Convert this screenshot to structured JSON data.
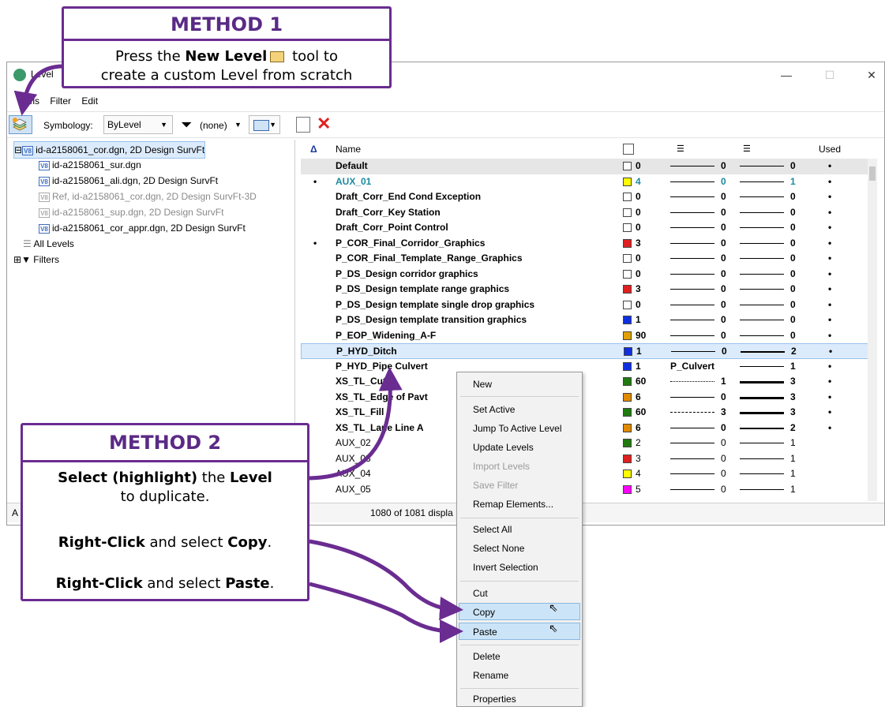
{
  "method1": {
    "heading": "METHOD 1",
    "line1_pre": "Press the ",
    "line1_bold": "New Level",
    "line1_post": " tool to",
    "line2": "create a custom Level from scratch"
  },
  "method2": {
    "heading": "METHOD 2",
    "p1_bold1": "Select (highlight)",
    "p1_mid": " the ",
    "p1_bold2": "Level",
    "p1_line2": "to duplicate.",
    "p2_bold": "Right-Click",
    "p2_mid": " and select ",
    "p2_bold2": "Copy",
    "p2_end": ".",
    "p3_bold": "Right-Click",
    "p3_mid": " and select ",
    "p3_bold2": "Paste",
    "p3_end": "."
  },
  "window": {
    "title": "Level",
    "minimize": "—",
    "maximize": "☐",
    "close": "✕"
  },
  "menubar": [
    "evels",
    "Filter",
    "Edit"
  ],
  "toolbar": {
    "symbology_label": "Symbology:",
    "symbology_value": "ByLevel",
    "filter_value": "(none)"
  },
  "tree": {
    "items": [
      "id-a2158061_cor.dgn, 2D Design SurvFt",
      "id-a2158061_sur.dgn",
      "id-a2158061_ali.dgn, 2D Design SurvFt",
      "Ref, id-a2158061_cor.dgn, 2D Design SurvFt-3D",
      "id-a2158061_sup.dgn, 2D Design SurvFt",
      "id-a2158061_cor_appr.dgn, 2D Design SurvFt",
      "All Levels",
      "Filters"
    ]
  },
  "list": {
    "header": {
      "sort": "Δ",
      "name": "Name",
      "used": "Used"
    },
    "rows": [
      {
        "active": "",
        "name": "Default",
        "color": "#ffffff",
        "cnum": "0",
        "style": "0",
        "weight": "0",
        "used": "•"
      },
      {
        "active": "•",
        "name": "AUX_01",
        "color": "#ffff00",
        "cnum": "4",
        "style": "0",
        "weight": "1",
        "used": "•"
      },
      {
        "active": "",
        "name": "Draft_Corr_End Cond Exception",
        "color": "#ffffff",
        "cnum": "0",
        "style": "0",
        "weight": "0",
        "used": "•"
      },
      {
        "active": "",
        "name": "Draft_Corr_Key Station",
        "color": "#ffffff",
        "cnum": "0",
        "style": "0",
        "weight": "0",
        "used": "•"
      },
      {
        "active": "",
        "name": "Draft_Corr_Point Control",
        "color": "#ffffff",
        "cnum": "0",
        "style": "0",
        "weight": "0",
        "used": "•"
      },
      {
        "active": "•",
        "name": "P_COR_Final_Corridor_Graphics",
        "color": "#e02020",
        "cnum": "3",
        "style": "0",
        "weight": "0",
        "used": "•"
      },
      {
        "active": "",
        "name": "P_COR_Final_Template_Range_Graphics",
        "color": "#ffffff",
        "cnum": "0",
        "style": "0",
        "weight": "0",
        "used": "•"
      },
      {
        "active": "",
        "name": "P_DS_Design corridor graphics",
        "color": "#ffffff",
        "cnum": "0",
        "style": "0",
        "weight": "0",
        "used": "•"
      },
      {
        "active": "",
        "name": "P_DS_Design template range graphics",
        "color": "#e02020",
        "cnum": "3",
        "style": "0",
        "weight": "0",
        "used": "•"
      },
      {
        "active": "",
        "name": "P_DS_Design template single drop graphics",
        "color": "#ffffff",
        "cnum": "0",
        "style": "0",
        "weight": "0",
        "used": "•"
      },
      {
        "active": "",
        "name": "P_DS_Design template transition graphics",
        "color": "#1030e0",
        "cnum": "1",
        "style": "0",
        "weight": "0",
        "used": "•"
      },
      {
        "active": "",
        "name": "P_EOP_Widening_A-F",
        "color": "#e0a000",
        "cnum": "90",
        "style": "0",
        "weight": "0",
        "used": "•"
      },
      {
        "active": "",
        "name": "P_HYD_Ditch",
        "color": "#1030e0",
        "cnum": "1",
        "style": "0",
        "weight": "2",
        "used": "•"
      },
      {
        "active": "",
        "name": "P_HYD_Pipe Culvert",
        "color": "#1030e0",
        "cnum": "1",
        "style": "P_Culvert",
        "weight": "1",
        "used": "•"
      },
      {
        "active": "",
        "name": "XS_TL_Cut",
        "color": "#207a10",
        "cnum": "60",
        "style": "1",
        "weight": "3",
        "used": "•"
      },
      {
        "active": "",
        "name": "XS_TL_Edge of Pavt",
        "color": "#e08a00",
        "cnum": "6",
        "style": "0",
        "weight": "3",
        "used": "•"
      },
      {
        "active": "",
        "name": "XS_TL_Fill",
        "color": "#207a10",
        "cnum": "60",
        "style": "3",
        "weight": "3",
        "used": "•"
      },
      {
        "active": "",
        "name": "XS_TL_Lane Line A",
        "color": "#e08a00",
        "cnum": "6",
        "style": "0",
        "weight": "2",
        "used": "•"
      },
      {
        "active": "",
        "name": "AUX_02",
        "color": "#207a10",
        "cnum": "2",
        "style": "0",
        "weight": "1",
        "used": ""
      },
      {
        "active": "",
        "name": "AUX_03",
        "color": "#e02020",
        "cnum": "3",
        "style": "0",
        "weight": "1",
        "used": ""
      },
      {
        "active": "",
        "name": "AUX_04",
        "color": "#ffff00",
        "cnum": "4",
        "style": "0",
        "weight": "1",
        "used": ""
      },
      {
        "active": "",
        "name": "AUX_05",
        "color": "#ff00ff",
        "cnum": "5",
        "style": "0",
        "weight": "1",
        "used": ""
      }
    ]
  },
  "status": {
    "left": "A",
    "count": "1080 of 1081 displa"
  },
  "context_menu": {
    "new": "New",
    "set_active": "Set Active",
    "jump": "Jump To Active Level",
    "update": "Update Levels",
    "import": "Import Levels",
    "save_filter": "Save Filter",
    "remap": "Remap Elements...",
    "select_all": "Select All",
    "select_none": "Select None",
    "invert": "Invert Selection",
    "cut": "Cut",
    "copy": "Copy",
    "paste": "Paste",
    "delete": "Delete",
    "rename": "Rename",
    "properties": "Properties"
  },
  "colors": {
    "accent": "#6a2c91",
    "highlight": "#cce4f7"
  }
}
